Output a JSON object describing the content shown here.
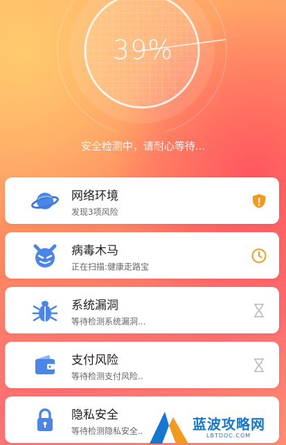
{
  "scan": {
    "progress_percent": 39,
    "progress_label": "39%",
    "status_text": "安全检测中，请耐心等待..."
  },
  "items": [
    {
      "title": "网络环境",
      "subtitle": "发现3项风险",
      "icon": "planet-icon",
      "status_icon": "warning-shield-icon"
    },
    {
      "title": "病毒木马",
      "subtitle": "正在扫描:健康走路宝",
      "icon": "devil-icon",
      "status_icon": "clock-icon"
    },
    {
      "title": "系统漏洞",
      "subtitle": "等待检测系统漏洞...",
      "icon": "bug-icon",
      "status_icon": "hourglass-icon"
    },
    {
      "title": "支付风险",
      "subtitle": "等待检测支付风险..",
      "icon": "wallet-icon",
      "status_icon": "hourglass-icon"
    },
    {
      "title": "隐私安全",
      "subtitle": "等待检测隐私安全..",
      "icon": "lock-icon",
      "status_icon": "hourglass-icon"
    }
  ],
  "watermark": {
    "title": "蓝波攻略网",
    "url": "LBTDOC.COM"
  },
  "colors": {
    "icon_blue": "#4a86e8",
    "warning_orange": "#f39a1e",
    "pending_gray": "#b8b8b8"
  }
}
